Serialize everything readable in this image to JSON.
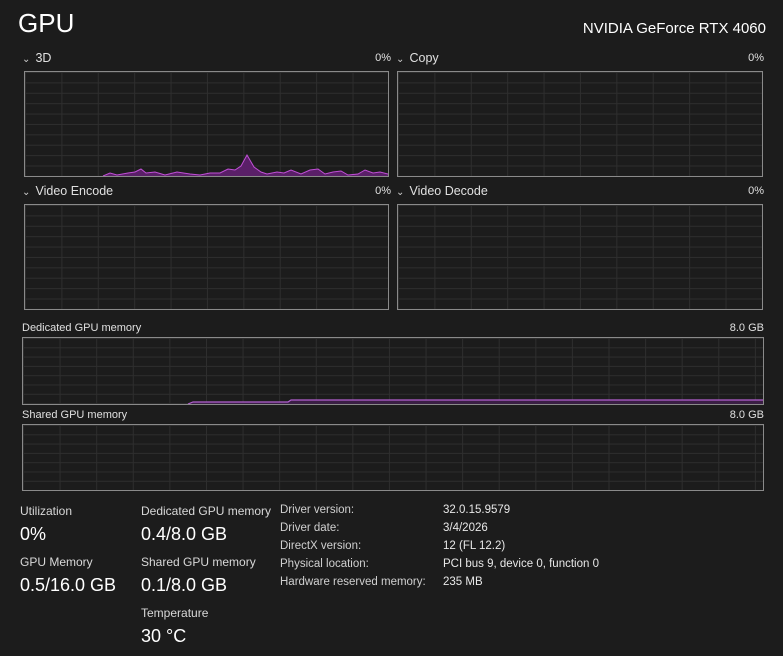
{
  "header": {
    "title": "GPU",
    "gpu_name": "NVIDIA GeForce RTX 4060"
  },
  "engines": [
    {
      "label": "3D",
      "value": "0%"
    },
    {
      "label": "Copy",
      "value": "0%"
    },
    {
      "label": "Video Encode",
      "value": "0%"
    },
    {
      "label": "Video Decode",
      "value": "0%"
    }
  ],
  "memory_graphs": {
    "dedicated": {
      "label": "Dedicated GPU memory",
      "value": "8.0 GB"
    },
    "shared": {
      "label": "Shared GPU memory",
      "value": "8.0 GB"
    }
  },
  "stats": {
    "utilization": {
      "label": "Utilization",
      "value": "0%"
    },
    "dedicated": {
      "label": "Dedicated GPU memory",
      "value": "0.4/8.0 GB"
    },
    "gpu_memory": {
      "label": "GPU Memory",
      "value": "0.5/16.0 GB"
    },
    "shared": {
      "label": "Shared GPU memory",
      "value": "0.1/8.0 GB"
    },
    "temperature": {
      "label": "Temperature",
      "value": "30 °C"
    }
  },
  "properties": [
    {
      "key": "Driver version:",
      "value": "32.0.15.9579"
    },
    {
      "key": "Driver date:",
      "value": "3/4/2026"
    },
    {
      "key": "DirectX version:",
      "value": "12 (FL 12.2)"
    },
    {
      "key": "Physical location:",
      "value": "PCI bus 9, device 0, function 0"
    },
    {
      "key": "Hardware reserved memory:",
      "value": "235 MB"
    }
  ],
  "colors": {
    "graph_line": "#c04fd6",
    "graph_fill": "#5a1f68",
    "memory_line": "#b25fd0"
  }
}
